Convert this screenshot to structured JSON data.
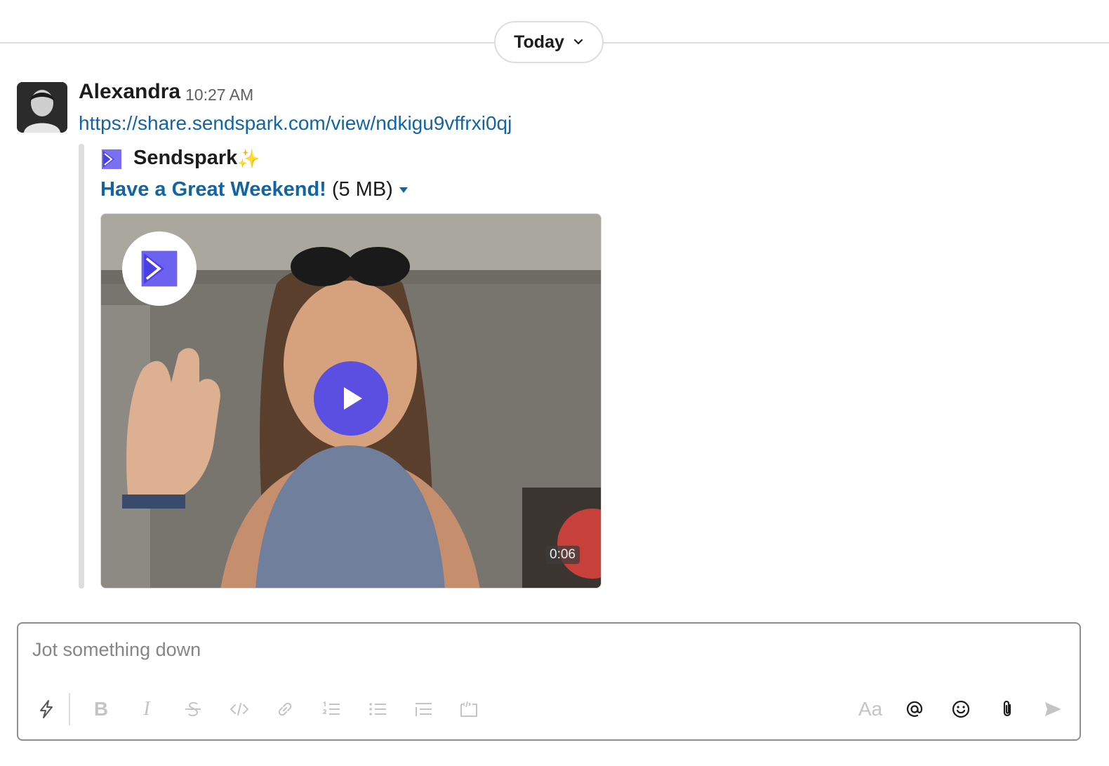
{
  "date_divider": {
    "label": "Today"
  },
  "message": {
    "sender": "Alexandra",
    "time": "10:27 AM",
    "link": "https://share.sendspark.com/view/ndkigu9vffrxi0qj",
    "attachment": {
      "brand": "Sendspark",
      "brand_emoji": "✨",
      "file_title": "Have a Great Weekend!",
      "file_size": "(5 MB)",
      "video_duration": "0:06"
    }
  },
  "composer": {
    "placeholder": "Jot something down",
    "toolbar": {
      "bold": "B",
      "italic": "I",
      "formatting": "Aa"
    }
  },
  "colors": {
    "link": "#1264a3",
    "brand_purple": "#5a4fe0",
    "muted_icon": "#c4c4c4"
  }
}
